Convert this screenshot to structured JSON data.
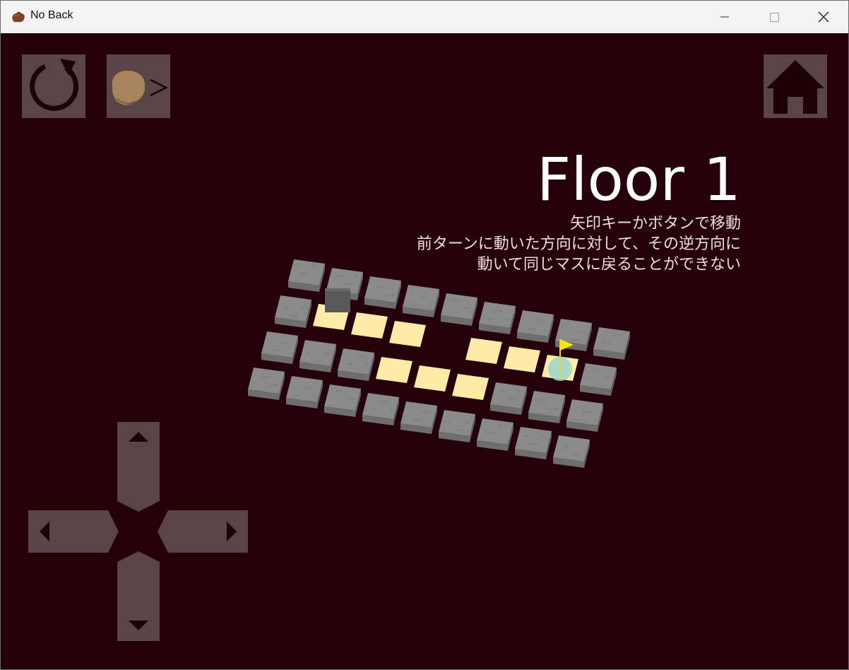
{
  "window": {
    "title": "No Back",
    "icon": "rock-icon"
  },
  "hud": {
    "restart_icon": "restart-arrow-icon",
    "skip_icon": "player-arrow-icon",
    "skip_glyph": ">",
    "home_icon": "house-icon"
  },
  "floor": {
    "title": "Floor 1",
    "instructions": [
      "矢印キーかボタンで移動",
      "前ターンに動いた方向に対して、その逆方向に",
      "動いて同じマスに戻ることができない"
    ]
  },
  "board": {
    "rows": 4,
    "cols": 9,
    "cells": [
      [
        "stone",
        "stone",
        "stone",
        "stone",
        "stone",
        "stone",
        "stone",
        "stone",
        "stone"
      ],
      [
        "stone",
        "start",
        "visited",
        "visited",
        "empty",
        "visited",
        "visited",
        "goal",
        "stone"
      ],
      [
        "stone",
        "stone",
        "stone",
        "visited",
        "visited",
        "visited",
        "stone",
        "stone",
        "stone"
      ],
      [
        "stone",
        "stone",
        "stone",
        "stone",
        "stone",
        "stone",
        "stone",
        "stone",
        "stone"
      ]
    ],
    "player": "dark-cube",
    "goal_marker": "flag-icon",
    "colors": {
      "stone_top": "#8a8a8a",
      "visited_top": "#fdeca8",
      "player": "#595959",
      "goal_glow": "#9fd4cc",
      "flag": "#f5e400",
      "background": "#25000a",
      "button": "#5a4448"
    }
  },
  "dpad": {
    "up_icon": "arrow-up-icon",
    "down_icon": "arrow-down-icon",
    "left_icon": "arrow-left-icon",
    "right_icon": "arrow-right-icon"
  }
}
